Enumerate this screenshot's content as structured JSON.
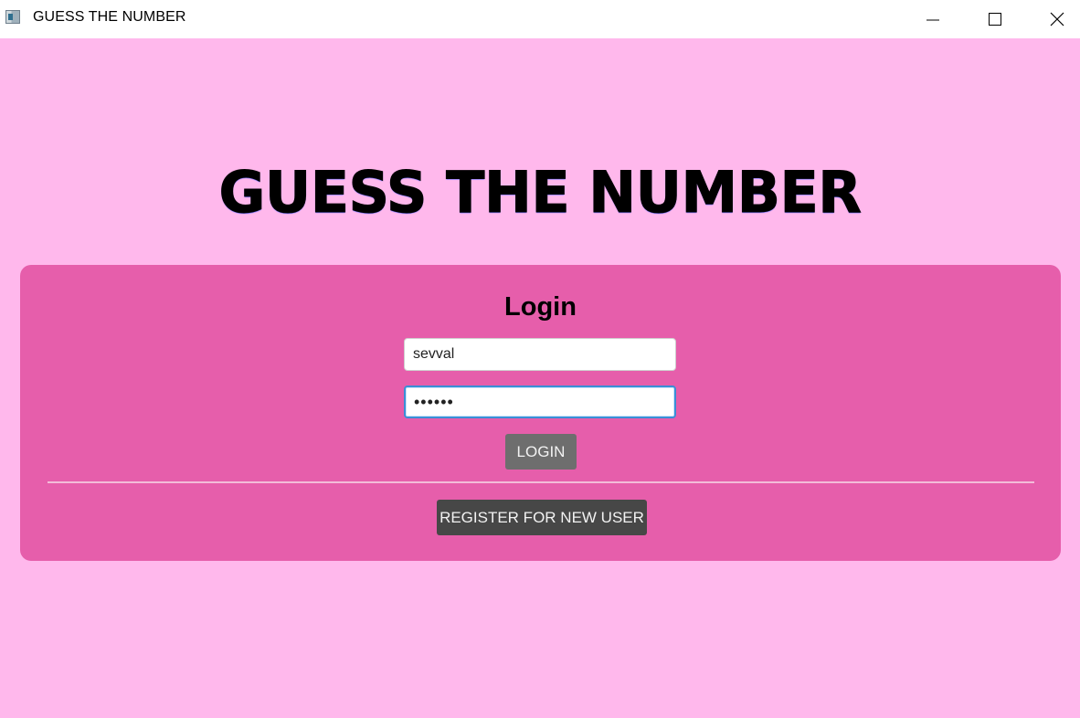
{
  "window": {
    "title": "GUESS THE NUMBER",
    "icons": {
      "app": "app-window-icon",
      "minimize": "minimize-icon",
      "maximize": "maximize-icon",
      "close": "close-icon"
    }
  },
  "main": {
    "heading": "GUESS THE NUMBER"
  },
  "login_panel": {
    "title": "Login",
    "username": {
      "value": "sevval"
    },
    "password": {
      "value": "••••••"
    },
    "login_label": "LOGIN",
    "register_label": "REGISTER FOR NEW USER"
  },
  "colors": {
    "background": "#ffb8ec",
    "panel": "#e65eab",
    "login_button": "#6e6e6e",
    "register_button": "#474747",
    "focus_border": "#3a8fd6"
  }
}
